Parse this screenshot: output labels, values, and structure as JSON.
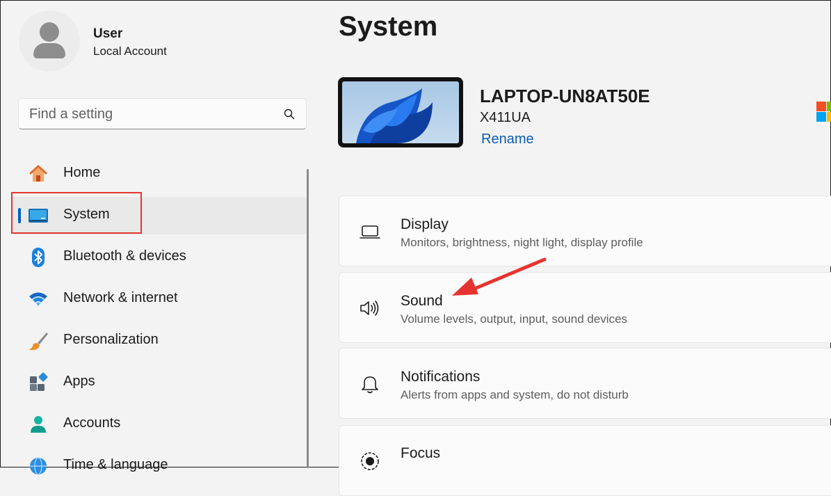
{
  "user": {
    "name": "User",
    "account_type": "Local Account"
  },
  "search": {
    "placeholder": "Find a setting"
  },
  "sidebar": {
    "items": [
      {
        "label": "Home",
        "icon": "home-icon"
      },
      {
        "label": "System",
        "icon": "system-icon",
        "active": true
      },
      {
        "label": "Bluetooth & devices",
        "icon": "bluetooth-icon"
      },
      {
        "label": "Network & internet",
        "icon": "wifi-icon"
      },
      {
        "label": "Personalization",
        "icon": "brush-icon"
      },
      {
        "label": "Apps",
        "icon": "apps-icon"
      },
      {
        "label": "Accounts",
        "icon": "person-icon"
      },
      {
        "label": "Time & language",
        "icon": "globe-clock-icon"
      }
    ]
  },
  "main": {
    "title": "System",
    "device": {
      "name": "LAPTOP-UN8AT50E",
      "model": "X411UA",
      "rename_label": "Rename"
    },
    "cards": [
      {
        "title": "Display",
        "subtitle": "Monitors, brightness, night light, display profile",
        "icon": "laptop-icon"
      },
      {
        "title": "Sound",
        "subtitle": "Volume levels, output, input, sound devices",
        "icon": "speaker-icon"
      },
      {
        "title": "Notifications",
        "subtitle": "Alerts from apps and system, do not disturb",
        "icon": "bell-icon"
      },
      {
        "title": "Focus",
        "subtitle": "",
        "icon": "focus-icon"
      }
    ]
  },
  "colors": {
    "accent": "#005fb8",
    "annotation": "#e5342f",
    "link": "#0b5cad"
  }
}
